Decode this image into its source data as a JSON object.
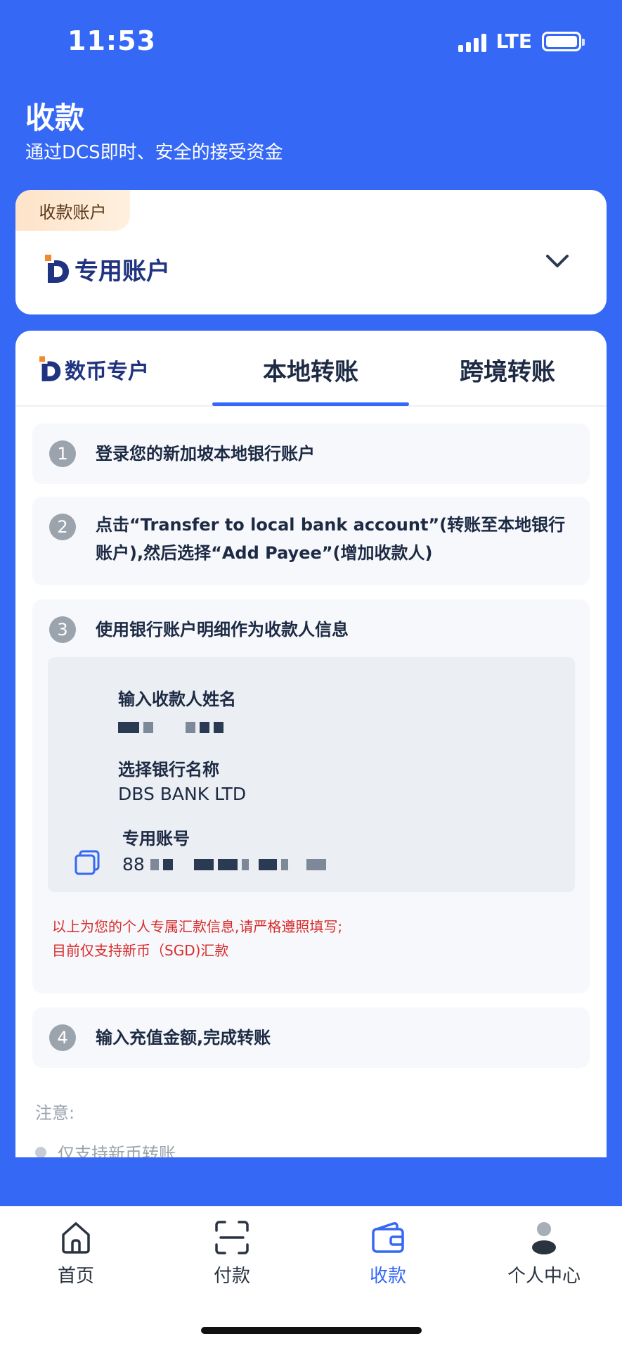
{
  "status_bar": {
    "time": "11:53",
    "network": "LTE"
  },
  "header": {
    "title": "收款",
    "subtitle": "通过DCS即时、安全的接受资金"
  },
  "account_card": {
    "badge": "收款账户",
    "account_name": "专用账户"
  },
  "tabs": [
    {
      "label": "数币专户",
      "active": false
    },
    {
      "label": "本地转账",
      "active": true
    },
    {
      "label": "跨境转账",
      "active": false
    }
  ],
  "steps": [
    {
      "number": "1",
      "text": "登录您的新加坡本地银行账户"
    },
    {
      "number": "2",
      "text": "点击“Transfer to local bank account”(转账至本地银行账户),然后选择“Add Payee”(增加收款人)"
    },
    {
      "number": "3",
      "text": "使用银行账户明细作为收款人信息"
    },
    {
      "number": "4",
      "text": "输入充值金额,完成转账"
    }
  ],
  "payee_info": {
    "name_label": "输入收款人姓名",
    "bank_label": "选择银行名称",
    "bank_value": "DBS BANK LTD",
    "account_label": "专用账号",
    "account_prefix": "88"
  },
  "warning": {
    "line1": "以上为您的个人专属汇款信息,请严格遵照填写;",
    "line2": "目前仅支持新币（SGD)汇款"
  },
  "notice": {
    "title": "注意:",
    "items": [
      "仅支持新币转账"
    ]
  },
  "bottom_nav": [
    {
      "label": "首页",
      "icon": "home-icon",
      "active": false
    },
    {
      "label": "付款",
      "icon": "scan-icon",
      "active": false
    },
    {
      "label": "收款",
      "icon": "wallet-icon",
      "active": true
    },
    {
      "label": "个人中心",
      "icon": "user-icon",
      "active": false
    }
  ],
  "colors": {
    "primary": "#3568f5",
    "brand_dark": "#1f3380",
    "brand_orange": "#f28a2c",
    "warning": "#d92c2c"
  }
}
